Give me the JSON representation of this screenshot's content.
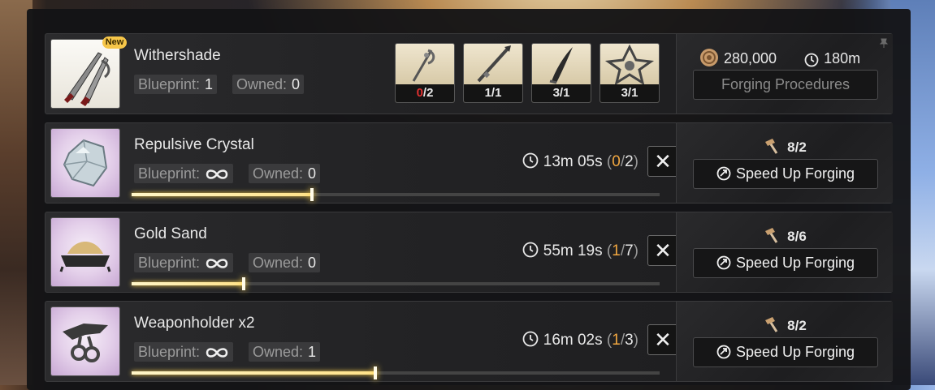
{
  "colors": {
    "accent_gold": "#f0a640",
    "alert_red": "#e03030",
    "text": "#e8e8e8",
    "muted": "#9a9a9a"
  },
  "header_item": {
    "new_badge": "New",
    "name": "Withershade",
    "blueprint_label": "Blueprint:",
    "blueprint_value": "1",
    "owned_label": "Owned:",
    "owned_value": "0",
    "materials": [
      {
        "icon": "staff-material-icon",
        "have": "0",
        "sep": "/",
        "need": "2"
      },
      {
        "icon": "spear-material-icon",
        "have": "1",
        "sep": "/",
        "need": "1"
      },
      {
        "icon": "blade-material-icon",
        "have": "3",
        "sep": "/",
        "need": "1"
      },
      {
        "icon": "star-frame-material-icon",
        "have": "3",
        "sep": "/",
        "need": "1"
      }
    ],
    "coin_cost": "280,000",
    "time_cost": "180m",
    "action": "Forging Procedures"
  },
  "queue": [
    {
      "name": "Repulsive Crystal",
      "blueprint_label": "Blueprint:",
      "owned_label": "Owned:",
      "owned_value": "0",
      "time_left": "13m 05s",
      "done": "0",
      "total": "2",
      "progress": 0.34,
      "hammers": "8/2",
      "action": "Speed Up Forging"
    },
    {
      "name": "Gold Sand",
      "blueprint_label": "Blueprint:",
      "owned_label": "Owned:",
      "owned_value": "0",
      "time_left": "55m 19s",
      "done": "1",
      "total": "7",
      "progress": 0.21,
      "hammers": "8/6",
      "action": "Speed Up Forging"
    },
    {
      "name": "Weaponholder x2",
      "blueprint_label": "Blueprint:",
      "owned_label": "Owned:",
      "owned_value": "1",
      "time_left": "16m 02s",
      "done": "1",
      "total": "3",
      "progress": 0.46,
      "hammers": "8/2",
      "action": "Speed Up Forging"
    }
  ],
  "cancel_symbol": "✕",
  "paren_open": "(",
  "paren_close": ")",
  "slash": "/"
}
